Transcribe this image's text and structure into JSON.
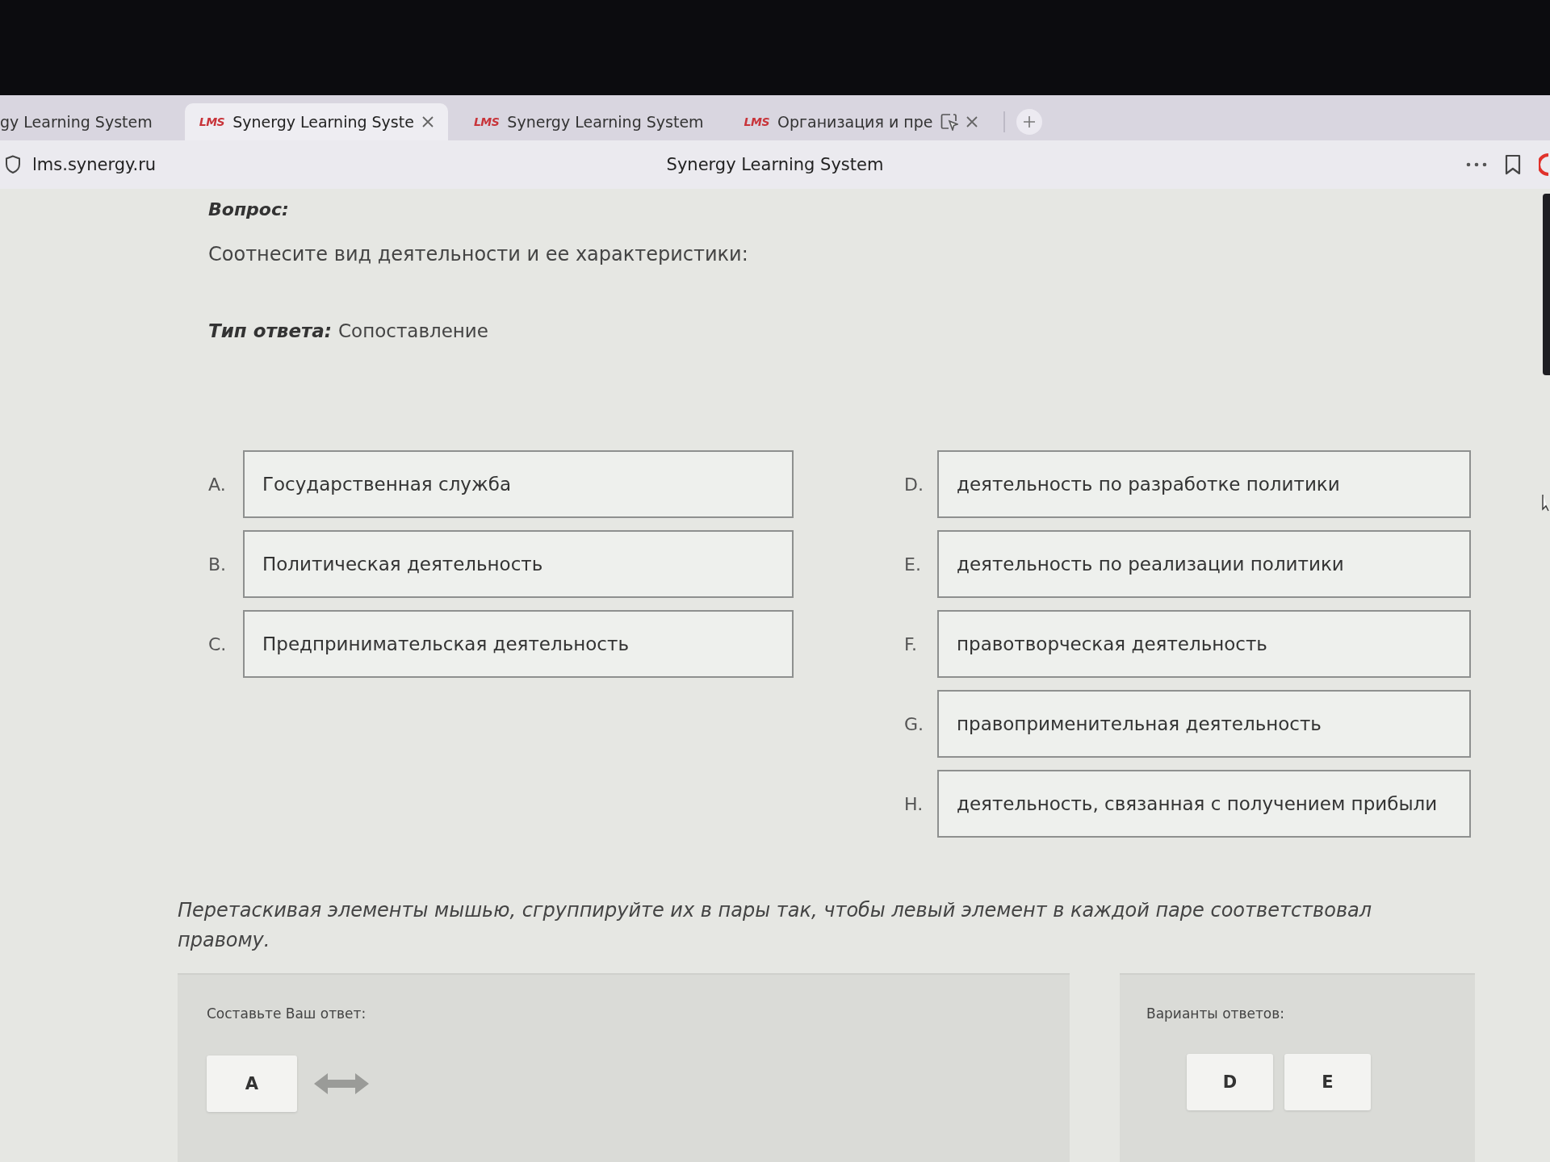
{
  "browser": {
    "tabs": [
      {
        "title": "gy Learning System",
        "selected": false,
        "close_button": false,
        "capture_icon": false
      },
      {
        "favicon": "LMS",
        "title": "Synergy Learning Syste",
        "selected": true,
        "close_button": true,
        "capture_icon": false
      },
      {
        "favicon": "LMS",
        "title": "Synergy Learning System",
        "selected": false,
        "close_button": false,
        "capture_icon": false
      },
      {
        "favicon": "LMS",
        "title": "Организация и пре",
        "selected": false,
        "close_button": true,
        "capture_icon": true
      }
    ],
    "url": "lms.synergy.ru",
    "page_title": "Synergy Learning System"
  },
  "question": {
    "heading": "Вопрос:",
    "text": "Соотнесите вид деятельности и ее характеристики:",
    "answer_type_label": "Тип ответа:",
    "answer_type": "Сопоставление"
  },
  "left_items": [
    {
      "letter": "A.",
      "text": "Государственная служба"
    },
    {
      "letter": "B.",
      "text": "Политическая деятельность"
    },
    {
      "letter": "C.",
      "text": "Предпринимательская деятельность"
    }
  ],
  "right_items": [
    {
      "letter": "D.",
      "text": "деятельность по разработке политики"
    },
    {
      "letter": "E.",
      "text": "деятельность по реализации политики"
    },
    {
      "letter": "F.",
      "text": "правотворческая деятельность"
    },
    {
      "letter": "G.",
      "text": "правоприменительная деятельность"
    },
    {
      "letter": "H.",
      "text": "деятельность, связанная с получением прибыли"
    }
  ],
  "instruction": "Перетаскивая элементы мышью, сгруппируйте их в пары так, чтобы левый элемент в каждой паре соответствовал правому.",
  "answer_panel": {
    "label": "Составьте Ваш ответ:",
    "pairs": [
      {
        "left": "A"
      }
    ]
  },
  "options_panel": {
    "label": "Варианты ответов:",
    "options": [
      "D",
      "E"
    ]
  }
}
